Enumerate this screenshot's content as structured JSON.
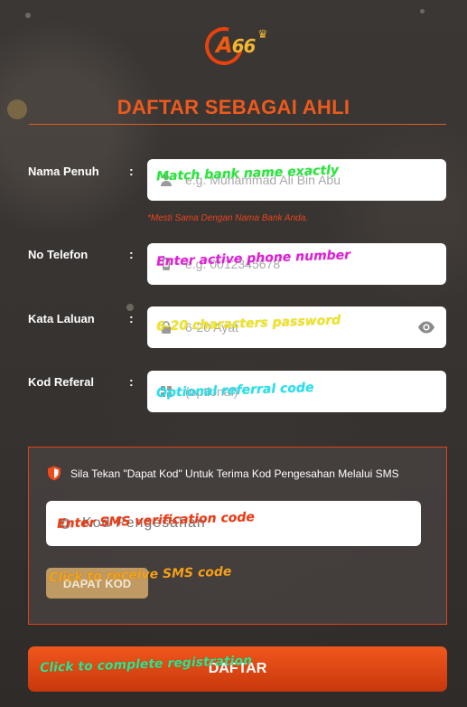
{
  "logo": {
    "letter": "A",
    "number": "66"
  },
  "page_title": "DAFTAR SEBAGAI AHLI",
  "form": {
    "colon": ":",
    "fields": [
      {
        "label": "Nama Penuh",
        "placeholder": "e.g. Muhammad Ali Bin Abu",
        "icon": "user-icon",
        "note": "*Mesti Sama Dengan Nama Bank Anda.",
        "annotation": "Match bank name exactly",
        "annotation_color": "#27e83a"
      },
      {
        "label": "No Telefon",
        "placeholder": "e.g. 0012345678",
        "icon": "phone-icon",
        "annotation": "Enter active phone number",
        "annotation_color": "#e11ed9"
      },
      {
        "label": "Kata Laluan",
        "placeholder": "6-20 Ayat",
        "icon": "lock-icon",
        "annotation": "6-20 characters password",
        "annotation_color": "#f1e51c"
      },
      {
        "label": "Kod Referal",
        "placeholder": "(optional)",
        "icon": "referral-icon",
        "annotation": "Optional referral code",
        "annotation_color": "#22e3ee"
      }
    ]
  },
  "sms": {
    "notice": "Sila Tekan \"Dapat Kod\" Untuk Terima Kod Pengesahan Melalui SMS",
    "code_placeholder": "Kod Pengesahan",
    "code_annotation": "Enter SMS verification code",
    "code_annotation_color": "#ef3a12",
    "get_code_label": "DAPAT KOD",
    "get_code_annotation": "Click to receive SMS code",
    "get_code_annotation_color": "#f5a21a"
  },
  "submit": {
    "label": "DAFTAR",
    "annotation": "Click to complete registration",
    "annotation_color": "#2ee58e"
  },
  "colors": {
    "accent": "#ef5a1c",
    "panel_border": "#e1421b",
    "get_code_bg": "#bf9a62"
  }
}
